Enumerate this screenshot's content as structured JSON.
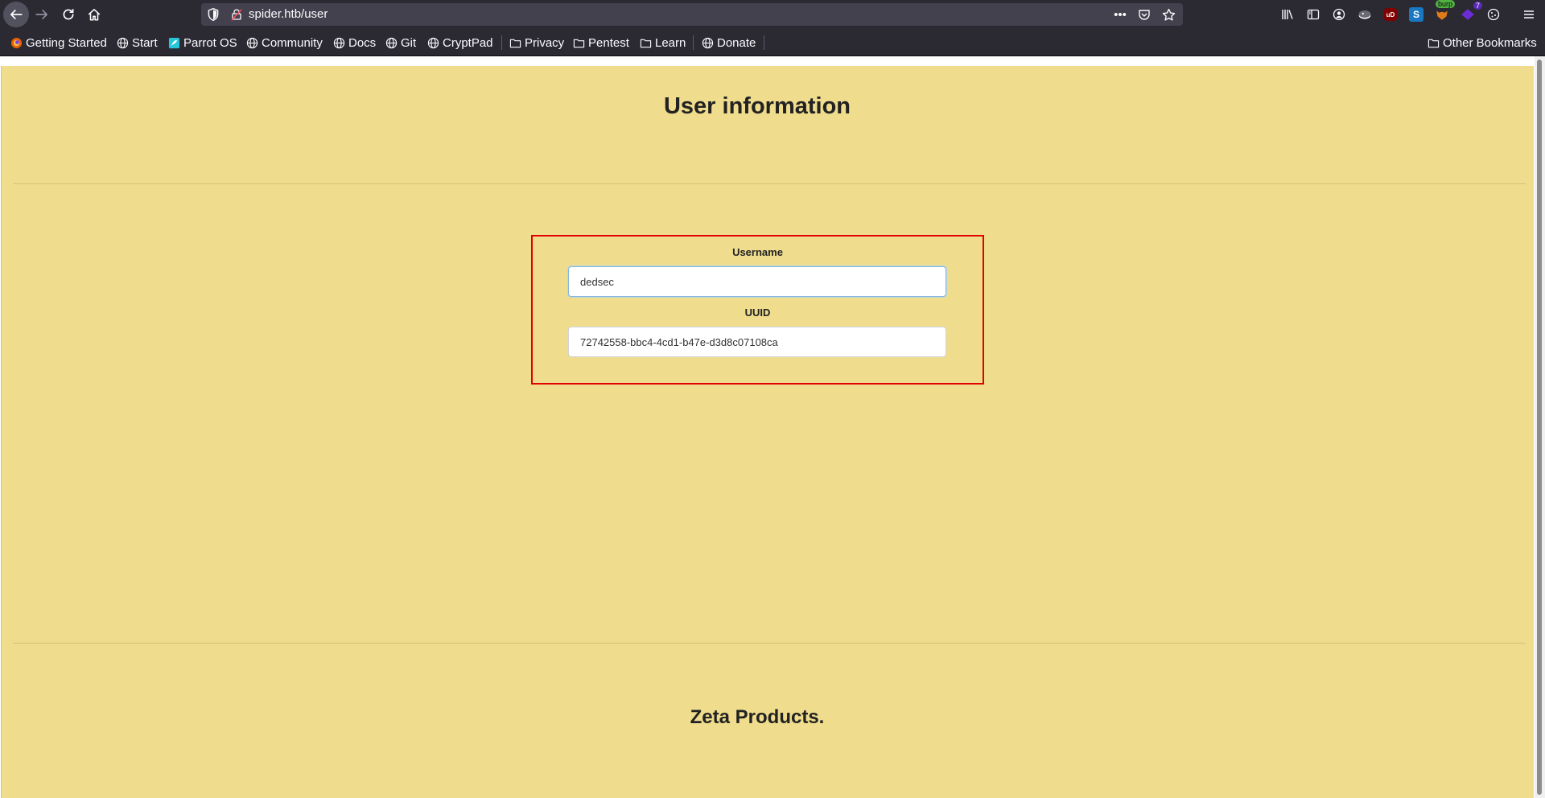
{
  "browser": {
    "url": "spider.htb/user",
    "bookmarks": [
      {
        "label": "Getting Started",
        "icon": "firefox-icon"
      },
      {
        "label": "Start",
        "icon": "globe-icon"
      },
      {
        "label": "Parrot OS",
        "icon": "parrot-icon"
      },
      {
        "label": "Community",
        "icon": "globe-icon"
      },
      {
        "label": "Docs",
        "icon": "globe-icon"
      },
      {
        "label": "Git",
        "icon": "globe-icon"
      },
      {
        "label": "CryptPad",
        "icon": "globe-icon"
      },
      {
        "label": "Privacy",
        "icon": "folder-icon"
      },
      {
        "label": "Pentest",
        "icon": "folder-icon"
      },
      {
        "label": "Learn",
        "icon": "folder-icon"
      },
      {
        "label": "Donate",
        "icon": "globe-icon"
      }
    ],
    "other_bookmarks": "Other Bookmarks",
    "extensions": {
      "ublock": "uD",
      "s": "S",
      "burp_badge": "burp",
      "count_badge": "7"
    }
  },
  "page": {
    "title": "User information",
    "username_label": "Username",
    "username_value": "dedsec",
    "uuid_label": "UUID",
    "uuid_value": "72742558-bbc4-4cd1-b47e-d3d8c07108ca",
    "footer_title": "Zeta Products."
  },
  "colors": {
    "page_background": "#efdc8c",
    "highlight_border": "#e00000",
    "browser_chrome": "#2b2a33"
  }
}
